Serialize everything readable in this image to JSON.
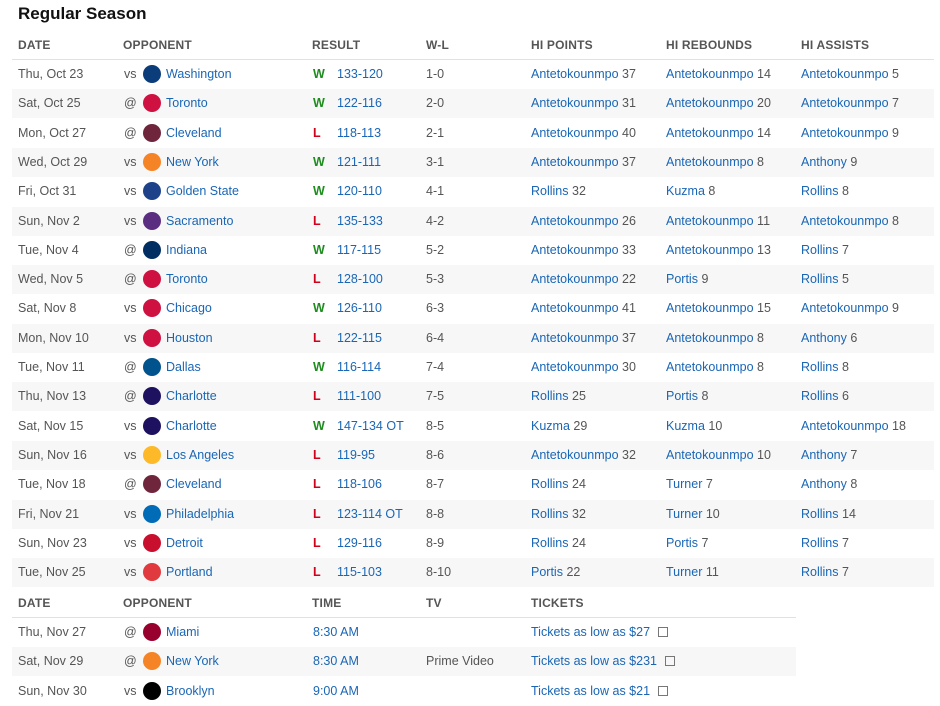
{
  "section_title": "Regular Season",
  "headers": {
    "date": "DATE",
    "opponent": "OPPONENT",
    "result": "RESULT",
    "wl": "W-L",
    "hi_points": "HI POINTS",
    "hi_rebounds": "HI REBOUNDS",
    "hi_assists": "HI ASSISTS"
  },
  "games": [
    {
      "date": "Thu, Oct 23",
      "prefix": "vs",
      "team": "Washington",
      "logo_color": "#0b3d7a",
      "wl": "W",
      "score": "133-120",
      "record": "1-0",
      "pts_name": "Antetokounmpo",
      "pts": "37",
      "reb_name": "Antetokounmpo",
      "reb": "14",
      "ast_name": "Antetokounmpo",
      "ast": "5"
    },
    {
      "date": "Sat, Oct 25",
      "prefix": "@",
      "team": "Toronto",
      "logo_color": "#ce1141",
      "wl": "W",
      "score": "122-116",
      "record": "2-0",
      "pts_name": "Antetokounmpo",
      "pts": "31",
      "reb_name": "Antetokounmpo",
      "reb": "20",
      "ast_name": "Antetokounmpo",
      "ast": "7"
    },
    {
      "date": "Mon, Oct 27",
      "prefix": "@",
      "team": "Cleveland",
      "logo_color": "#6f263d",
      "wl": "L",
      "score": "118-113",
      "record": "2-1",
      "pts_name": "Antetokounmpo",
      "pts": "40",
      "reb_name": "Antetokounmpo",
      "reb": "14",
      "ast_name": "Antetokounmpo",
      "ast": "9"
    },
    {
      "date": "Wed, Oct 29",
      "prefix": "vs",
      "team": "New York",
      "logo_color": "#f58426",
      "wl": "W",
      "score": "121-111",
      "record": "3-1",
      "pts_name": "Antetokounmpo",
      "pts": "37",
      "reb_name": "Antetokounmpo",
      "reb": "8",
      "ast_name": "Anthony",
      "ast": "9"
    },
    {
      "date": "Fri, Oct 31",
      "prefix": "vs",
      "team": "Golden State",
      "logo_color": "#1d428a",
      "wl": "W",
      "score": "120-110",
      "record": "4-1",
      "pts_name": "Rollins",
      "pts": "32",
      "reb_name": "Kuzma",
      "reb": "8",
      "ast_name": "Rollins",
      "ast": "8"
    },
    {
      "date": "Sun, Nov 2",
      "prefix": "vs",
      "team": "Sacramento",
      "logo_color": "#5a2d81",
      "wl": "L",
      "score": "135-133",
      "record": "4-2",
      "pts_name": "Antetokounmpo",
      "pts": "26",
      "reb_name": "Antetokounmpo",
      "reb": "11",
      "ast_name": "Antetokounmpo",
      "ast": "8"
    },
    {
      "date": "Tue, Nov 4",
      "prefix": "@",
      "team": "Indiana",
      "logo_color": "#002d62",
      "wl": "W",
      "score": "117-115",
      "record": "5-2",
      "pts_name": "Antetokounmpo",
      "pts": "33",
      "reb_name": "Antetokounmpo",
      "reb": "13",
      "ast_name": "Rollins",
      "ast": "7"
    },
    {
      "date": "Wed, Nov 5",
      "prefix": "@",
      "team": "Toronto",
      "logo_color": "#ce1141",
      "wl": "L",
      "score": "128-100",
      "record": "5-3",
      "pts_name": "Antetokounmpo",
      "pts": "22",
      "reb_name": "Portis",
      "reb": "9",
      "ast_name": "Rollins",
      "ast": "5"
    },
    {
      "date": "Sat, Nov 8",
      "prefix": "vs",
      "team": "Chicago",
      "logo_color": "#ce1141",
      "wl": "W",
      "score": "126-110",
      "record": "6-3",
      "pts_name": "Antetokounmpo",
      "pts": "41",
      "reb_name": "Antetokounmpo",
      "reb": "15",
      "ast_name": "Antetokounmpo",
      "ast": "9"
    },
    {
      "date": "Mon, Nov 10",
      "prefix": "vs",
      "team": "Houston",
      "logo_color": "#ce1141",
      "wl": "L",
      "score": "122-115",
      "record": "6-4",
      "pts_name": "Antetokounmpo",
      "pts": "37",
      "reb_name": "Antetokounmpo",
      "reb": "8",
      "ast_name": "Anthony",
      "ast": "6"
    },
    {
      "date": "Tue, Nov 11",
      "prefix": "@",
      "team": "Dallas",
      "logo_color": "#00538c",
      "wl": "W",
      "score": "116-114",
      "record": "7-4",
      "pts_name": "Antetokounmpo",
      "pts": "30",
      "reb_name": "Antetokounmpo",
      "reb": "8",
      "ast_name": "Rollins",
      "ast": "8"
    },
    {
      "date": "Thu, Nov 13",
      "prefix": "@",
      "team": "Charlotte",
      "logo_color": "#1d1160",
      "wl": "L",
      "score": "111-100",
      "record": "7-5",
      "pts_name": "Rollins",
      "pts": "25",
      "reb_name": "Portis",
      "reb": "8",
      "ast_name": "Rollins",
      "ast": "6"
    },
    {
      "date": "Sat, Nov 15",
      "prefix": "vs",
      "team": "Charlotte",
      "logo_color": "#1d1160",
      "wl": "W",
      "score": "147-134 OT",
      "record": "8-5",
      "pts_name": "Kuzma",
      "pts": "29",
      "reb_name": "Kuzma",
      "reb": "10",
      "ast_name": "Antetokounmpo",
      "ast": "18"
    },
    {
      "date": "Sun, Nov 16",
      "prefix": "vs",
      "team": "Los Angeles",
      "logo_color": "#fdb927",
      "wl": "L",
      "score": "119-95",
      "record": "8-6",
      "pts_name": "Antetokounmpo",
      "pts": "32",
      "reb_name": "Antetokounmpo",
      "reb": "10",
      "ast_name": "Anthony",
      "ast": "7"
    },
    {
      "date": "Tue, Nov 18",
      "prefix": "@",
      "team": "Cleveland",
      "logo_color": "#6f263d",
      "wl": "L",
      "score": "118-106",
      "record": "8-7",
      "pts_name": "Rollins",
      "pts": "24",
      "reb_name": "Turner",
      "reb": "7",
      "ast_name": "Anthony",
      "ast": "8"
    },
    {
      "date": "Fri, Nov 21",
      "prefix": "vs",
      "team": "Philadelphia",
      "logo_color": "#006bb6",
      "wl": "L",
      "score": "123-114 OT",
      "record": "8-8",
      "pts_name": "Rollins",
      "pts": "32",
      "reb_name": "Turner",
      "reb": "10",
      "ast_name": "Rollins",
      "ast": "14"
    },
    {
      "date": "Sun, Nov 23",
      "prefix": "vs",
      "team": "Detroit",
      "logo_color": "#c8102e",
      "wl": "L",
      "score": "129-116",
      "record": "8-9",
      "pts_name": "Rollins",
      "pts": "24",
      "reb_name": "Portis",
      "reb": "7",
      "ast_name": "Rollins",
      "ast": "7"
    },
    {
      "date": "Tue, Nov 25",
      "prefix": "vs",
      "team": "Portland",
      "logo_color": "#e03a3e",
      "wl": "L",
      "score": "115-103",
      "record": "8-10",
      "pts_name": "Portis",
      "pts": "22",
      "reb_name": "Turner",
      "reb": "11",
      "ast_name": "Rollins",
      "ast": "7"
    }
  ],
  "upcoming_headers": {
    "date": "DATE",
    "opponent": "OPPONENT",
    "time": "TIME",
    "tv": "TV",
    "tickets": "TICKETS"
  },
  "upcoming": [
    {
      "date": "Thu, Nov 27",
      "prefix": "@",
      "team": "Miami",
      "logo_color": "#98002e",
      "time": "8:30 AM",
      "tv": "",
      "tickets": "Tickets as low as $27"
    },
    {
      "date": "Sat, Nov 29",
      "prefix": "@",
      "team": "New York",
      "logo_color": "#f58426",
      "time": "8:30 AM",
      "tv": "Prime Video",
      "tickets": "Tickets as low as $231"
    },
    {
      "date": "Sun, Nov 30",
      "prefix": "vs",
      "team": "Brooklyn",
      "logo_color": "#000000",
      "time": "9:00 AM",
      "tv": "",
      "tickets": "Tickets as low as $21"
    }
  ]
}
